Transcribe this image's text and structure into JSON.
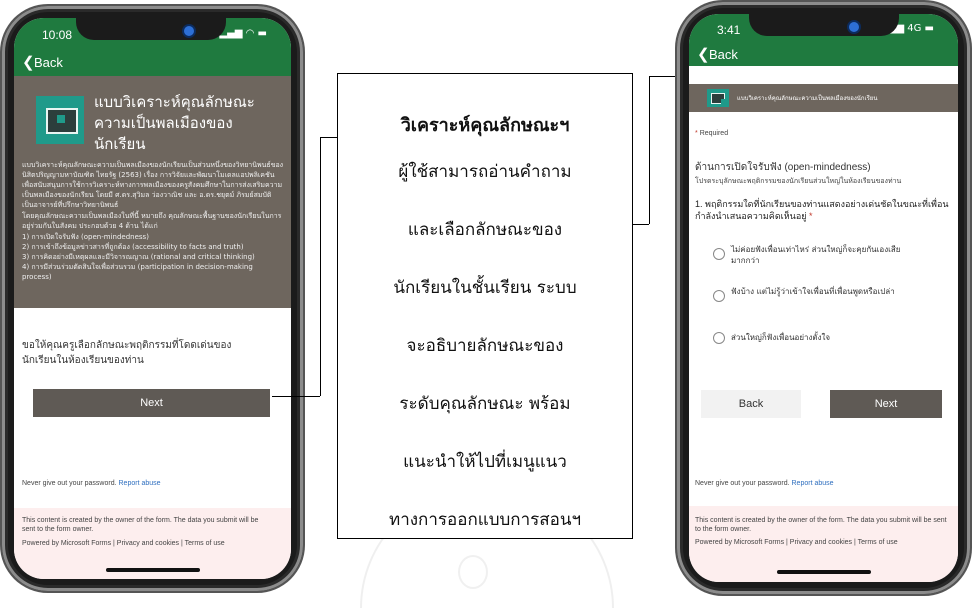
{
  "left_phone": {
    "time": "10:08",
    "back": "Back",
    "form_title": "แบบวิเคราะห์คุณลักษณะความเป็นพลเมืองของนักเรียน",
    "description_1": "แบบวิเคราะห์คุณลักษณะความเป็นพลเมืองของนักเรียนเป็นส่วนหนึ่งของวิทยานิพนธ์ของนิสิตปริญญามหาบัณฑิต ไทยรัฐ (2563) เรื่อง การวิจัยและพัฒนาโมเดลแอปพลิเคชันเพื่อสนับสนุนการใช้การวิเคราะห์ทางการพลเมืองของครูสังคมศึกษาในการส่งเสริมความเป็นพลเมืองของนักเรียน โดยมี ศ.ดร.สุวิมล ว่องวาณิช และ อ.ดร.ชยุตม์ ภิรมย์สมบัติ เป็นอาจารย์ที่ปรึกษาวิทยานิพนธ์",
    "description_2": "โดยคุณลักษณะความเป็นพลเมืองในที่นี้ หมายถึง คุณลักษณะพื้นฐานของนักเรียนในการอยู่ร่วมกันในสังคม ประกอบด้วย 4 ด้าน ได้แก่",
    "traits": [
      "1) การเปิดใจรับฟัง (open-mindedness)",
      "2) การเข้าถึงข้อมูลข่าวสารที่ถูกต้อง (accessibility to facts and truth)",
      "3) การคิดอย่างมีเหตุผลและมีวิจารณญาณ (rational and critical thinking)",
      "4) การมีส่วนร่วมตัดสินใจเพื่อส่วนรวม (participation in decision-making process)"
    ],
    "prompt": "ขอให้คุณครูเลือกลักษณะพฤติกรรมที่โดดเด่นของนักเรียนในห้องเรียนของท่าน",
    "next": "Next",
    "password_warning": "Never give out your password.",
    "report": "Report abuse",
    "owner_notice": "This content is created by the owner of the form. The data you submit will be sent to the form owner.",
    "powered": "Powered by Microsoft Forms | Privacy and cookies | Terms of use"
  },
  "callout": {
    "title": "วิเคราะห์คุณลักษณะฯ",
    "lines": [
      "ผู้ใช้สามารถอ่านคำถาม",
      "และเลือกลักษณะของ",
      "นักเรียนในชั้นเรียน ระบบ",
      "จะอธิบายลักษณะของ",
      "ระดับคุณลักษณะ พร้อม",
      "แนะนำให้ไปที่เมนูแนว",
      "ทางการออกแบบการสอนฯ"
    ]
  },
  "right_phone": {
    "time": "3:41",
    "network": "4G",
    "back": "Back",
    "form_title": "แบบวิเคราะห์คุณลักษณะความเป็นพลเมืองของนักเรียน",
    "required_mark": "*",
    "required": "Required",
    "section": "ด้านการเปิดใจรับฟัง (open-mindedness)",
    "section_hint": "โปรดระบุลักษณะพฤติกรรมของนักเรียนส่วนใหญ่ในห้องเรียนของท่าน",
    "question": "1. พฤติกรรมใดที่นักเรียนของท่านแสดงอย่างเด่นชัดในขณะที่เพื่อนกำลังนำเสนอความคิดเห็นอยู่",
    "question_required_mark": "*",
    "options": [
      "ไม่ค่อยฟังเพื่อนเท่าไหร่ ส่วนใหญ่ก็จะคุยกันเองเสียมากกว่า",
      "ฟังบ้าง แต่ไม่รู้ว่าเข้าใจเพื่อนที่เพื่อนพูดหรือเปล่า",
      "ส่วนใหญ่ก็ฟังเพื่อนอย่างตั้งใจ"
    ],
    "back_button": "Back",
    "next": "Next",
    "password_warning": "Never give out your password.",
    "report": "Report abuse",
    "owner_notice": "This content is created by the owner of the form. The data you submit will be sent to the form owner.",
    "powered": "Powered by Microsoft Forms | Privacy and cookies | Terms of use"
  }
}
